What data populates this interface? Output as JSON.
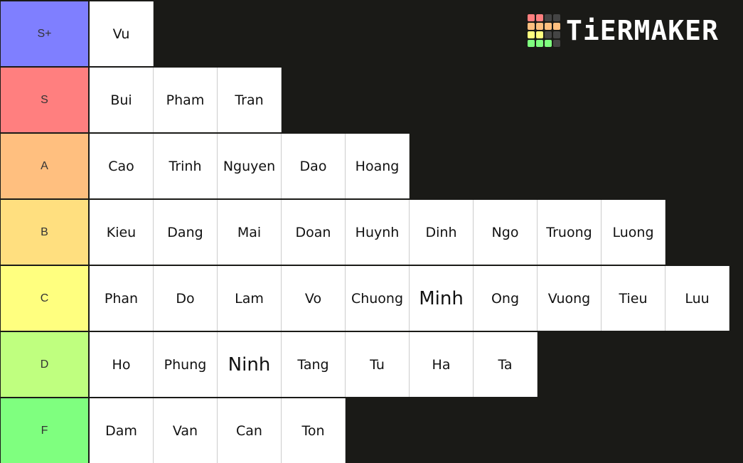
{
  "logo": {
    "text": "TiERMAKER",
    "grid_colors": [
      "#ff7f7f",
      "#ff7f7f",
      "#444444",
      "#444444",
      "#ffbf7f",
      "#ffbf7f",
      "#ffbf7f",
      "#ffbf7f",
      "#ffff7f",
      "#ffff7f",
      "#444444",
      "#444444",
      "#7fff7f",
      "#7fff7f",
      "#7fff7f",
      "#444444"
    ]
  },
  "tiers": [
    {
      "label": "S+",
      "color": "#7f7fff",
      "items": [
        "Vu"
      ]
    },
    {
      "label": "S",
      "color": "#ff7f7f",
      "items": [
        "Bui",
        "Pham",
        "Tran"
      ]
    },
    {
      "label": "A",
      "color": "#ffbf7f",
      "items": [
        "Cao",
        "Trinh",
        "Nguyen",
        "Dao",
        "Hoang"
      ]
    },
    {
      "label": "B",
      "color": "#ffdf7f",
      "items": [
        "Kieu",
        "Dang",
        "Mai",
        "Doan",
        "Huynh",
        "Dinh",
        "Ngo",
        "Truong",
        "Luong"
      ]
    },
    {
      "label": "C",
      "color": "#ffff7f",
      "items": [
        "Phan",
        "Do",
        "Lam",
        "Vo",
        "Chuong",
        "Minh",
        "Ong",
        "Vuong",
        "Tieu",
        "Luu"
      ]
    },
    {
      "label": "D",
      "color": "#bfff7f",
      "items": [
        "Ho",
        "Phung",
        "Ninh",
        "Tang",
        "Tu",
        "Ha",
        "Ta"
      ]
    },
    {
      "label": "F",
      "color": "#7fff7f",
      "items": [
        "Dam",
        "Van",
        "Can",
        "Ton"
      ]
    }
  ],
  "big_items": [
    "Minh",
    "Ninh"
  ]
}
